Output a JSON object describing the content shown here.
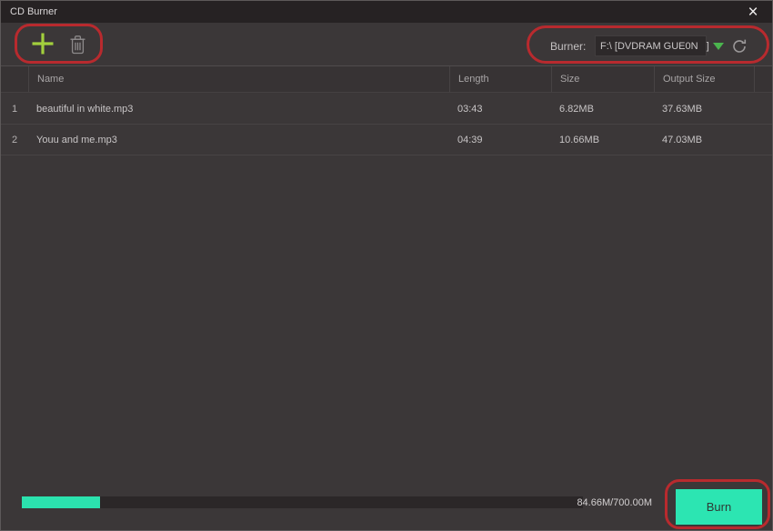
{
  "window": {
    "title": "CD Burner"
  },
  "icons": {
    "close": "×",
    "add": "plus-cross",
    "delete": "trash-can",
    "burner_caret": "chevron-down-triangle",
    "refresh": "circular-arrow"
  },
  "burner": {
    "label": "Burner:",
    "device": "F:\\ [DVDRAM GUE0N   ]"
  },
  "table": {
    "columns": [
      "Name",
      "Length",
      "Size",
      "Output Size"
    ],
    "tracks": [
      {
        "index": "1",
        "name": "beautiful in white.mp3",
        "length": "03:43",
        "size": "6.82MB",
        "output_size": "37.63MB"
      },
      {
        "index": "2",
        "name": "Youu and me.mp3",
        "length": "04:39",
        "size": "10.66MB",
        "output_size": "47.03MB"
      }
    ]
  },
  "footer": {
    "capacity": "84.66M/700.00M",
    "progress_percent": 14,
    "burn_label": "Burn"
  },
  "colors": {
    "accent_teal": "#2ce5b2",
    "accent_green": "#a2cf3d",
    "annotation_red": "#b82a2e",
    "background": "#3b3738",
    "titlebar": "#262223"
  }
}
